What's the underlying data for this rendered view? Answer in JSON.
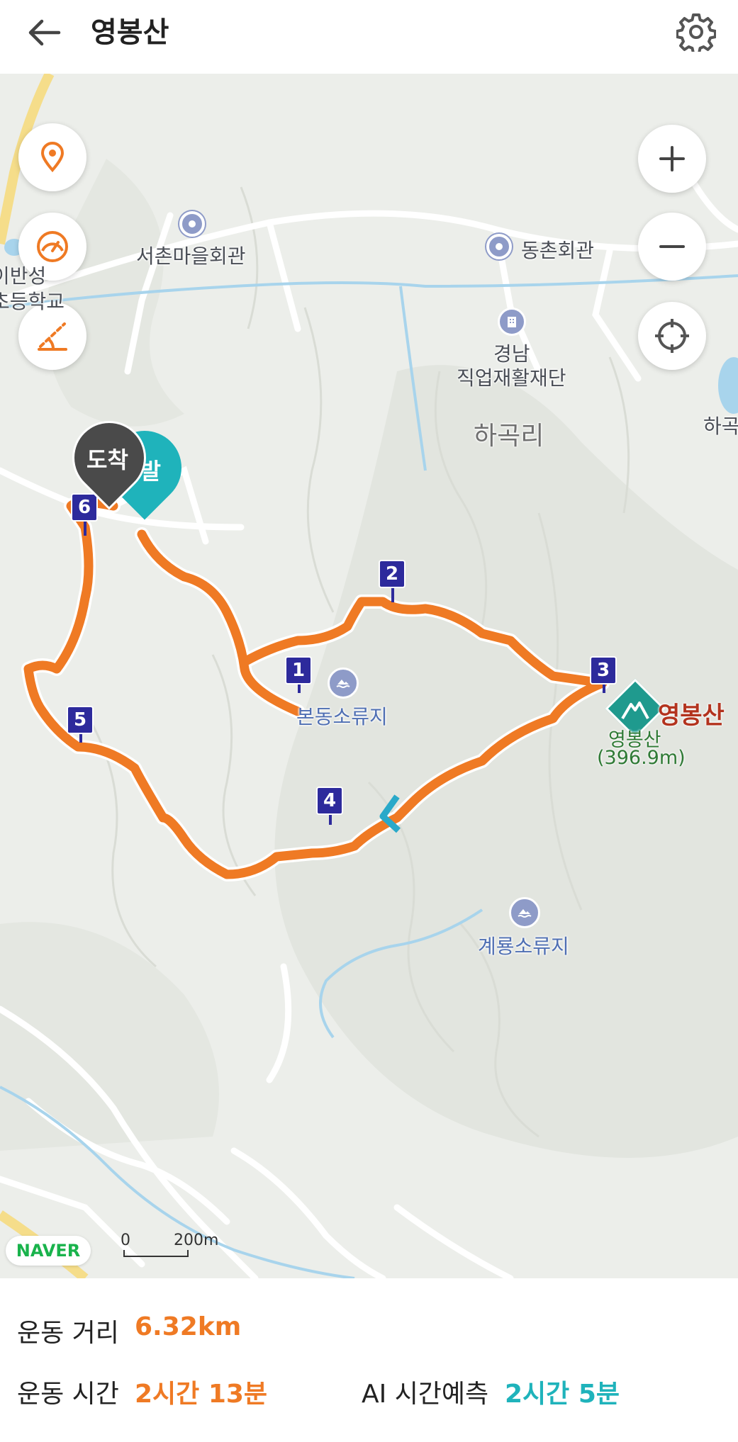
{
  "header": {
    "title": "영봉산",
    "back_icon": "arrow-left-icon",
    "settings_icon": "gear-icon"
  },
  "map": {
    "controls": {
      "left": [
        "location-pin-icon",
        "speedometer-icon",
        "slope-icon"
      ],
      "right": [
        "zoom-in-icon",
        "zoom-out-icon",
        "crosshair-icon"
      ]
    },
    "places": {
      "seochon": "서촌마을회관",
      "dongchon": "동촌회관",
      "rehab_line1": "경남",
      "rehab_line2": "직업재활재단",
      "hagok": "하곡리",
      "hagok_edge": "하곡",
      "bondong": "본동소류지",
      "gyeryong": "계룡소류지",
      "school_line1": "이반성",
      "school_line2": "초등학교"
    },
    "peak": {
      "name": "영봉산",
      "sub_name": "영봉산",
      "elevation": "(396.9m)"
    },
    "markers": {
      "arrival": "도착",
      "departure": "출발"
    },
    "waypoints": [
      "1",
      "2",
      "3",
      "4",
      "5",
      "6"
    ],
    "route_color": "#ef7a24",
    "brand": "NAVER",
    "scale": {
      "zero": "0",
      "distance": "200m"
    }
  },
  "stats": {
    "distance_label": "운동 거리",
    "distance_value": "6.32km",
    "time_label": "운동 시간",
    "time_value": "2시간 13분",
    "ai_label": "AI 시간예측",
    "ai_value": "2시간 5분"
  },
  "colors": {
    "accent_orange": "#ef7a24",
    "accent_teal": "#1fb3bb",
    "waypoint_blue": "#2d2a9c",
    "arrival_gray": "#4a4a4a"
  }
}
